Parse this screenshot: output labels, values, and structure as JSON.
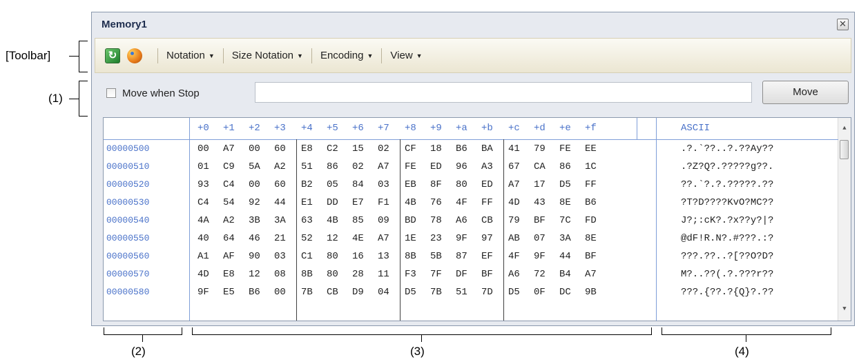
{
  "annotations": {
    "toolbar": "[Toolbar]",
    "one": "(1)",
    "two": "(2)",
    "three": "(3)",
    "four": "(4)"
  },
  "window": {
    "title": "Memory1"
  },
  "toolbar": {
    "icons": [
      "refresh-icon",
      "palette-icon"
    ],
    "menus": [
      "Notation",
      "Size Notation",
      "Encoding",
      "View"
    ]
  },
  "move_bar": {
    "checkbox_label": "Move when Stop",
    "checked": false,
    "address_value": "",
    "move_button": "Move"
  },
  "grid": {
    "offset_headers": [
      "+0",
      "+1",
      "+2",
      "+3",
      "+4",
      "+5",
      "+6",
      "+7",
      "+8",
      "+9",
      "+a",
      "+b",
      "+c",
      "+d",
      "+e",
      "+f"
    ],
    "ascii_header": "ASCII",
    "rows": [
      {
        "addr": "00000500",
        "bytes": [
          "00",
          "A7",
          "00",
          "60",
          "E8",
          "C2",
          "15",
          "02",
          "CF",
          "18",
          "B6",
          "BA",
          "41",
          "79",
          "FE",
          "EE"
        ],
        "ascii": ".?.`??..?.??Ay??"
      },
      {
        "addr": "00000510",
        "bytes": [
          "01",
          "C9",
          "5A",
          "A2",
          "51",
          "86",
          "02",
          "A7",
          "FE",
          "ED",
          "96",
          "A3",
          "67",
          "CA",
          "86",
          "1C"
        ],
        "ascii": ".?Z?Q?.?????g??."
      },
      {
        "addr": "00000520",
        "bytes": [
          "93",
          "C4",
          "00",
          "60",
          "B2",
          "05",
          "84",
          "03",
          "EB",
          "8F",
          "80",
          "ED",
          "A7",
          "17",
          "D5",
          "FF"
        ],
        "ascii": "??.`?.?.?????.??"
      },
      {
        "addr": "00000530",
        "bytes": [
          "C4",
          "54",
          "92",
          "44",
          "E1",
          "DD",
          "E7",
          "F1",
          "4B",
          "76",
          "4F",
          "FF",
          "4D",
          "43",
          "8E",
          "B6"
        ],
        "ascii": "?T?D????KvO?MC??"
      },
      {
        "addr": "00000540",
        "bytes": [
          "4A",
          "A2",
          "3B",
          "3A",
          "63",
          "4B",
          "85",
          "09",
          "BD",
          "78",
          "A6",
          "CB",
          "79",
          "BF",
          "7C",
          "FD"
        ],
        "ascii": "J?;:cK?.?x??y?|?"
      },
      {
        "addr": "00000550",
        "bytes": [
          "40",
          "64",
          "46",
          "21",
          "52",
          "12",
          "4E",
          "A7",
          "1E",
          "23",
          "9F",
          "97",
          "AB",
          "07",
          "3A",
          "8E"
        ],
        "ascii": "@dF!R.N?.#???.:?"
      },
      {
        "addr": "00000560",
        "bytes": [
          "A1",
          "AF",
          "90",
          "03",
          "C1",
          "80",
          "16",
          "13",
          "8B",
          "5B",
          "87",
          "EF",
          "4F",
          "9F",
          "44",
          "BF"
        ],
        "ascii": "???.??..?[??O?D?"
      },
      {
        "addr": "00000570",
        "bytes": [
          "4D",
          "E8",
          "12",
          "08",
          "8B",
          "80",
          "28",
          "11",
          "F3",
          "7F",
          "DF",
          "BF",
          "A6",
          "72",
          "B4",
          "A7"
        ],
        "ascii": "M?..??(.?.???r??"
      },
      {
        "addr": "00000580",
        "bytes": [
          "9F",
          "E5",
          "B6",
          "00",
          "7B",
          "CB",
          "D9",
          "04",
          "D5",
          "7B",
          "51",
          "7D",
          "D5",
          "0F",
          "DC",
          "9B"
        ],
        "ascii": "???.{??.?{Q}?.??"
      }
    ]
  }
}
